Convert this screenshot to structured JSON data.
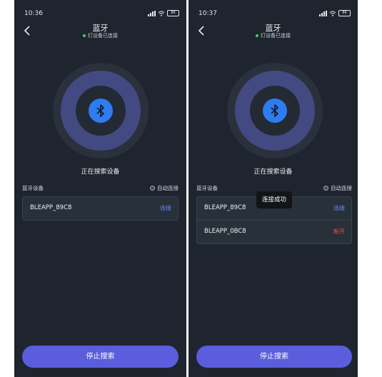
{
  "left": {
    "status": {
      "time": "10:36",
      "battery": "86"
    },
    "header": {
      "title": "蓝牙",
      "subtitle": "灯设备已连接"
    },
    "searching_text": "正在搜索设备",
    "section": {
      "label": "蓝牙设备",
      "auto_connect": "自动连接"
    },
    "devices": [
      {
        "name": "BLEAPP_89C8",
        "action": "连接"
      }
    ],
    "stop_button": "停止搜索"
  },
  "right": {
    "status": {
      "time": "10:37",
      "battery": "86"
    },
    "header": {
      "title": "蓝牙",
      "subtitle": "灯设备已连接"
    },
    "searching_text": "正在搜索设备",
    "section": {
      "label": "蓝牙设备",
      "auto_connect": "自动连接"
    },
    "devices": [
      {
        "name": "BLEAPP_89C8",
        "action": "连接"
      },
      {
        "name": "BLEAPP_0BC8",
        "action": "断开"
      }
    ],
    "toast": "连接成功",
    "stop_button": "停止搜索"
  },
  "colors": {
    "background": "#1f252e",
    "accent": "#5a5ddc",
    "bluetooth": "#2f7cf0",
    "connect": "#6d86f5",
    "disconnect": "#ef4b4b",
    "connected_dot": "#3ecf6b"
  },
  "icons": [
    "back-arrow-icon",
    "bluetooth-icon",
    "signal-icon",
    "wifi-icon",
    "battery-icon"
  ]
}
